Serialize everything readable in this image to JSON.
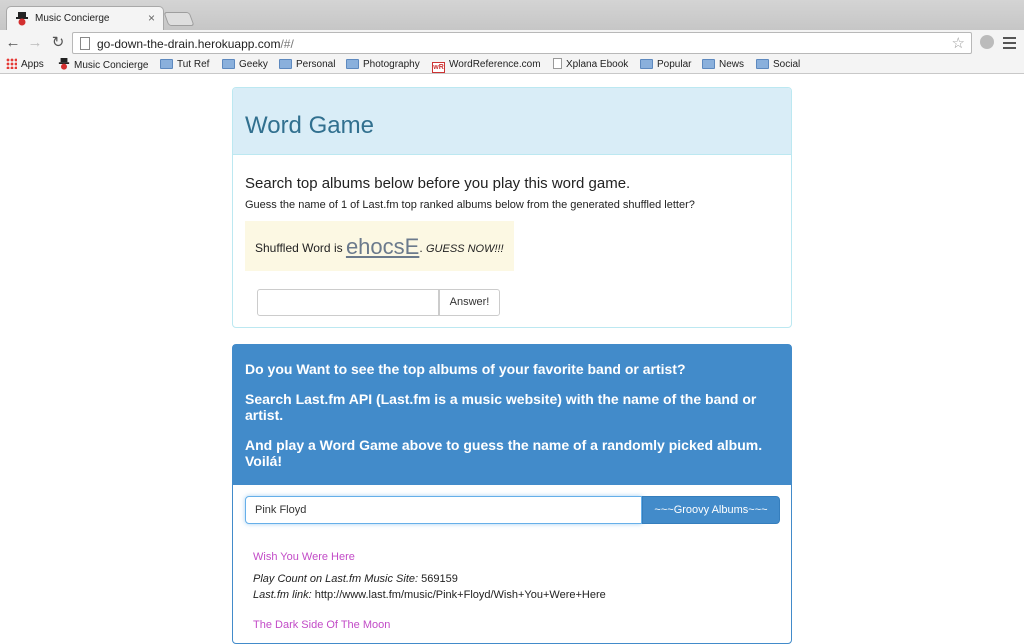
{
  "browser": {
    "tab_title": "Music Concierge",
    "tab_close": "×",
    "url_host": "go-down-the-drain.herokuapp.com",
    "url_path": "/#/",
    "back": "←",
    "forward": "→",
    "reload": "↻",
    "star": "☆",
    "bookmarks": [
      {
        "label": "Apps",
        "icon": "apps-icon"
      },
      {
        "label": "Music Concierge",
        "icon": "music-concierge-icon"
      },
      {
        "label": "Tut Ref",
        "icon": "folder-icon"
      },
      {
        "label": "Geeky",
        "icon": "folder-icon"
      },
      {
        "label": "Personal",
        "icon": "folder-icon"
      },
      {
        "label": "Photography",
        "icon": "folder-icon"
      },
      {
        "label": "WordReference.com",
        "icon": "wordreference-icon"
      },
      {
        "label": "Xplana Ebook",
        "icon": "document-icon"
      },
      {
        "label": "Popular",
        "icon": "folder-icon"
      },
      {
        "label": "News",
        "icon": "folder-icon"
      },
      {
        "label": "Social",
        "icon": "folder-icon"
      }
    ]
  },
  "game": {
    "title": "Word Game",
    "intro": "Search top albums below before you play this word game.",
    "desc_prefix": "Guess the name of ",
    "desc_count": "1",
    "desc_suffix": " of Last.fm top ranked albums below from the generated shuffled letter?",
    "shuffle_prefix": "Shuffled Word is ",
    "shuffled_word": "ehocsE",
    "shuffle_suffix": ". ",
    "guess_now": "GUESS NOW!!!",
    "answer_button": "Answer!",
    "answer_value": ""
  },
  "search": {
    "line1": "Do you Want to see the top albums of your favorite band or artist?",
    "line2": "Search Last.fm API (Last.fm is a music website) with the name of the band or artist.",
    "line3": "And play a Word Game above to guess the name of a randomly picked album. Voilá!",
    "query": "Pink Floyd",
    "button": "~~~Groovy Albums~~~",
    "play_count_label": "Play Count on Last.fm Music Site:",
    "link_label": "Last.fm link:",
    "results": [
      {
        "title": "Wish You Were Here",
        "play_count": "569159",
        "link": "http://www.last.fm/music/Pink+Floyd/Wish+You+Were+Here"
      },
      {
        "title": "The Dark Side Of The Moon"
      }
    ]
  }
}
